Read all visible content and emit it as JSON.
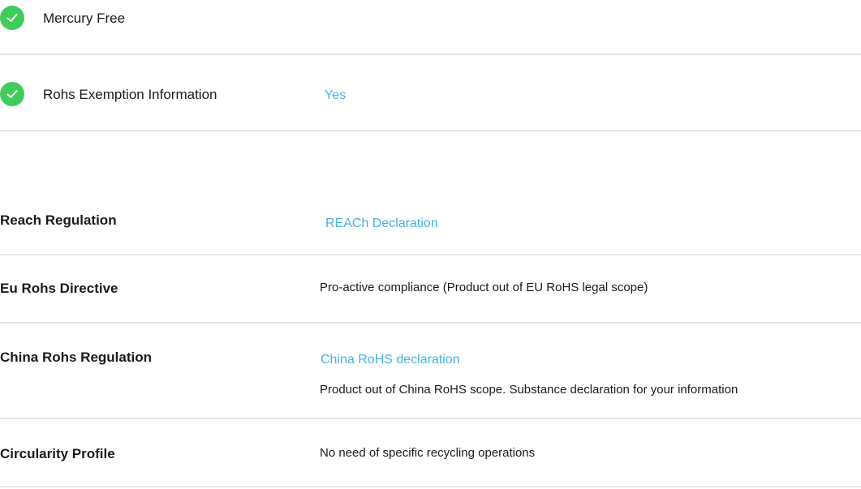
{
  "environmental_checks": [
    {
      "label": "Mercury Free",
      "value": ""
    },
    {
      "label": "Rohs Exemption Information",
      "value": "Yes"
    }
  ],
  "regulations": {
    "reach": {
      "label": "Reach Regulation",
      "link": "REACh Declaration"
    },
    "eu_rohs": {
      "label": "Eu Rohs Directive",
      "text": "Pro-active compliance (Product out of EU RoHS legal scope)"
    },
    "china_rohs": {
      "label": "China Rohs Regulation",
      "link": "China RoHS declaration",
      "text": "Product out of China RoHS scope. Substance declaration for your information"
    },
    "circularity": {
      "label": "Circularity Profile",
      "text": "No need of specific recycling operations"
    }
  },
  "colors": {
    "check_green": "#3dcd58",
    "link_blue": "#42b4e6",
    "divider": "#e6e6e6"
  },
  "icons": {
    "check": "check-circle-icon"
  }
}
